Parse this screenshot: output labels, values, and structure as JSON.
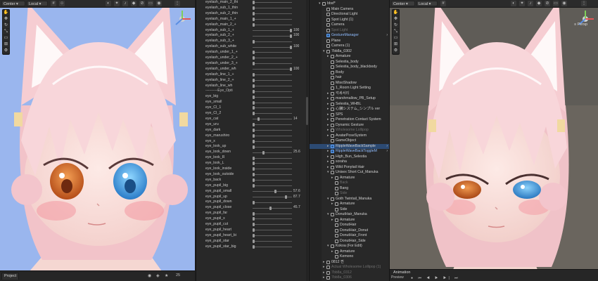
{
  "left_view": {
    "toolbar": {
      "pivot": "Center ▾",
      "space": "Local ▾"
    },
    "project_tab": "Project",
    "counter": "25"
  },
  "inspector": {
    "rows": [
      {
        "label": "eyelash_main_2_thi",
        "value": null,
        "pos": 0.0
      },
      {
        "label": "eyelash_sub_1_thin",
        "value": null,
        "pos": 0.0
      },
      {
        "label": "eyelash_sub_2_thin",
        "value": null,
        "pos": 0.0
      },
      {
        "label": "eyelash_main_1_+",
        "value": null,
        "pos": 0.0
      },
      {
        "label": "eyelash_main_2_+",
        "value": null,
        "pos": 0.0
      },
      {
        "label": "eyelash_sub_1_+",
        "value": "100",
        "pos": 1.0
      },
      {
        "label": "eyelash_sub_2_+",
        "value": "100",
        "pos": 1.0
      },
      {
        "label": "eyelash_sub_3_+",
        "value": null,
        "pos": 0.0
      },
      {
        "label": "eyelash_sub_white",
        "value": "100",
        "pos": 1.0
      },
      {
        "label": "eyelash_under_1_+",
        "value": null,
        "pos": 0.0
      },
      {
        "label": "eyelash_under_2_+",
        "value": null,
        "pos": 0.0
      },
      {
        "label": "eyelash_under_3_+",
        "value": null,
        "pos": 0.0
      },
      {
        "label": "eyelash_under_wh",
        "value": "100",
        "pos": 1.0
      },
      {
        "label": "eyelash_line_1_+",
        "value": null,
        "pos": 0.0
      },
      {
        "label": "eyelash_line_2_+",
        "value": null,
        "pos": 0.0
      },
      {
        "label": "eyelash_line_wh",
        "value": null,
        "pos": 0.0
      },
      {
        "label": "----------Eye_Opti",
        "value": null,
        "pos": 0.0,
        "header": true
      },
      {
        "label": "eye_big",
        "value": null,
        "pos": 0.0
      },
      {
        "label": "eye_small",
        "value": null,
        "pos": 0.0
      },
      {
        "label": "eye_CI_1",
        "value": null,
        "pos": 0.0
      },
      {
        "label": "eye_CI_2",
        "value": null,
        "pos": 0.0
      },
      {
        "label": "eye_cat",
        "value": "14",
        "pos": 0.14
      },
      {
        "label": "eye_uru",
        "value": null,
        "pos": 0.0
      },
      {
        "label": "eye_dark",
        "value": null,
        "pos": 0.0
      },
      {
        "label": "eye_marushiro",
        "value": null,
        "pos": 0.0
      },
      {
        "label": "eye_x",
        "value": null,
        "pos": 0.0
      },
      {
        "label": "eye_look_up",
        "value": null,
        "pos": 0.0
      },
      {
        "label": "eye_look_down",
        "value": "25.6",
        "pos": 0.256
      },
      {
        "label": "eye_look_R",
        "value": null,
        "pos": 0.0
      },
      {
        "label": "eye_look_L",
        "value": null,
        "pos": 0.0
      },
      {
        "label": "eye_look_inside",
        "value": null,
        "pos": 0.0
      },
      {
        "label": "eye_look_outside",
        "value": null,
        "pos": 0.0
      },
      {
        "label": "eye_back",
        "value": null,
        "pos": 0.0
      },
      {
        "label": "eye_pupil_big",
        "value": null,
        "pos": 0.0
      },
      {
        "label": "eye_pupil_small",
        "value": "57.6",
        "pos": 0.576
      },
      {
        "label": "eye_pupil_up",
        "value": "87.7",
        "pos": 0.877
      },
      {
        "label": "eye_pupil_down",
        "value": null,
        "pos": 0.0
      },
      {
        "label": "eye_pupil_close",
        "value": "45.7",
        "pos": 0.457
      },
      {
        "label": "eye_pupil_far",
        "value": null,
        "pos": 0.0
      },
      {
        "label": "eye_pupil_x",
        "value": null,
        "pos": 0.0
      },
      {
        "label": "eye_pupil_cut",
        "value": null,
        "pos": 0.0
      },
      {
        "label": "eye_pupil_heart",
        "value": null,
        "pos": 0.0
      },
      {
        "label": "eye_pupil_heart_bi",
        "value": null,
        "pos": 0.0
      },
      {
        "label": "eye_pupil_star",
        "value": null,
        "pos": 0.0
      },
      {
        "label": "eye_pupil_star_big",
        "value": null,
        "pos": 0.0
      }
    ]
  },
  "hierarchy": {
    "rows": [
      {
        "label": "bbsf*",
        "indent": 0,
        "fold": "▾",
        "style": "scene"
      },
      {
        "label": "Main Camera",
        "indent": 1
      },
      {
        "label": "Directional Light",
        "indent": 1
      },
      {
        "label": "Spot Light (1)",
        "indent": 1
      },
      {
        "label": "Camera",
        "indent": 1
      },
      {
        "label": "Spot Light",
        "indent": 1,
        "style": "dim"
      },
      {
        "label": "GestureManager",
        "indent": 1,
        "style": "blue",
        "menu": "›"
      },
      {
        "label": "Plane",
        "indent": 1
      },
      {
        "label": "Camera (1)",
        "indent": 1
      },
      {
        "label": "7bb8a_0302",
        "indent": 1,
        "fold": "▾"
      },
      {
        "label": "Armature",
        "indent": 2,
        "fold": "▸"
      },
      {
        "label": "Selestia_body",
        "indent": 2
      },
      {
        "label": "Selestia_body_blackbody",
        "indent": 2
      },
      {
        "label": "Body",
        "indent": 2
      },
      {
        "label": "hair",
        "indent": 2
      },
      {
        "label": "MisoShadow",
        "indent": 2
      },
      {
        "label": "1_Room Light Setting",
        "indent": 2
      },
      {
        "label": "각세서리",
        "indent": 2,
        "fold": "▸"
      },
      {
        "label": "marshmallow_PB_Setup",
        "indent": 2,
        "fold": "▸"
      },
      {
        "label": "Selestia_WHBL",
        "indent": 2,
        "fold": "▸"
      },
      {
        "label": "心臓システム_シンプル ver",
        "indent": 2,
        "fold": "▸"
      },
      {
        "label": "SPS",
        "indent": 2,
        "fold": "▸"
      },
      {
        "label": "Penetration Contact System",
        "indent": 2,
        "fold": "▸"
      },
      {
        "label": "Dynamic Gesture",
        "indent": 2,
        "fold": "▸"
      },
      {
        "label": "Wholesome Lollipop",
        "indent": 2,
        "fold": "▸",
        "style": "dim"
      },
      {
        "label": "AvatarPoseSystem",
        "indent": 2,
        "fold": "▸"
      },
      {
        "label": "GameObject",
        "indent": 2
      },
      {
        "label": "RippleWaveBackSample",
        "indent": 2,
        "fold": "▸",
        "style": "sel",
        "menu": "›"
      },
      {
        "label": "RippleWaveBackToggleM",
        "indent": 2,
        "fold": "▸",
        "style": "blue",
        "menu": "›"
      },
      {
        "label": "High_Bun_Selestia",
        "indent": 2,
        "fold": "▸"
      },
      {
        "label": "soraha",
        "indent": 2,
        "fold": "▸"
      },
      {
        "label": "Wild Ponytail Hair",
        "indent": 2,
        "fold": "▸"
      },
      {
        "label": "Unisex Short Cut_Manuka",
        "indent": 2,
        "fold": "▾"
      },
      {
        "label": "Armature",
        "indent": 3,
        "fold": "▸"
      },
      {
        "label": "Back",
        "indent": 3,
        "style": "dim"
      },
      {
        "label": "Bang",
        "indent": 3
      },
      {
        "label": "Side",
        "indent": 3,
        "style": "dim"
      },
      {
        "label": "Goth Twintail_Manuka",
        "indent": 2,
        "fold": "▾"
      },
      {
        "label": "Armature",
        "indent": 3,
        "fold": "▸"
      },
      {
        "label": "Side",
        "indent": 3
      },
      {
        "label": "DonutHair_Manuka",
        "indent": 2,
        "fold": "▾"
      },
      {
        "label": "Armature",
        "indent": 3,
        "fold": "▸"
      },
      {
        "label": "DonutHair",
        "indent": 3
      },
      {
        "label": "DonutHair_Donut",
        "indent": 3
      },
      {
        "label": "DonutHair_Front",
        "indent": 3
      },
      {
        "label": "DonutHair_Side",
        "indent": 3
      },
      {
        "label": "Kokoa (For Edit)",
        "indent": 2,
        "fold": "▾"
      },
      {
        "label": "Armature",
        "indent": 3,
        "fold": "▸"
      },
      {
        "label": "Kemono",
        "indent": 3
      },
      {
        "label": "0812 찐",
        "indent": 1,
        "fold": "▸"
      },
      {
        "label": "Actual Wholesome Lollipop (1)",
        "indent": 1,
        "fold": "▸",
        "style": "dim"
      },
      {
        "label": "7bb8a_0312",
        "indent": 1,
        "fold": "▸",
        "style": "dim"
      },
      {
        "label": "7bb8a_0306",
        "indent": 1,
        "fold": "▸",
        "style": "dim"
      },
      {
        "label": "7bb8a_0306 (1)",
        "indent": 1,
        "fold": "▸",
        "style": "dim"
      }
    ]
  },
  "right_view": {
    "toolbar": {
      "pivot": "Center ▾",
      "space": "Local ▾"
    },
    "persp_label": "≡ Persp",
    "animation_tab": "Animation",
    "preview_label": "Preview"
  },
  "colors": {
    "skin": "#fbe4e0",
    "hair": "#f7d2d6",
    "iris_left": "#e07a32",
    "iris_right": "#5db7f0",
    "selection": "#2c4a72"
  }
}
